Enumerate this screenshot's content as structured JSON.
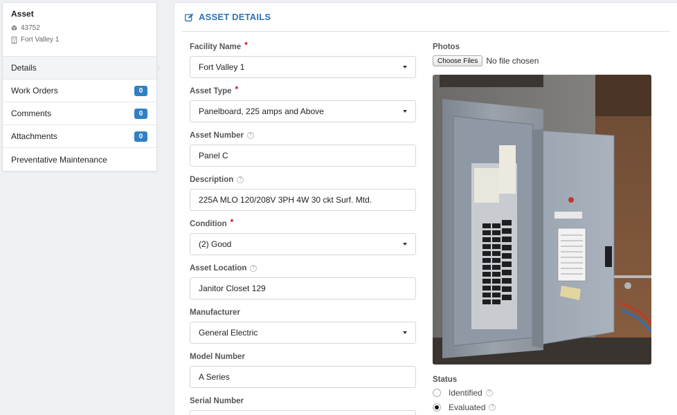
{
  "sidebar": {
    "asset_title": "Asset",
    "asset_id": "43752",
    "facility": "Fort Valley 1",
    "items": [
      {
        "label": "Details",
        "badge": null
      },
      {
        "label": "Work Orders",
        "badge": "0"
      },
      {
        "label": "Comments",
        "badge": "0"
      },
      {
        "label": "Attachments",
        "badge": "0"
      },
      {
        "label": "Preventative Maintenance",
        "badge": null
      }
    ]
  },
  "main": {
    "title": "ASSET DETAILS",
    "fields": {
      "facility_name": {
        "label": "Facility Name",
        "value": "Fort Valley 1"
      },
      "asset_type": {
        "label": "Asset Type",
        "value": "Panelboard, 225 amps and Above"
      },
      "asset_number": {
        "label": "Asset Number",
        "value": "Panel C"
      },
      "description": {
        "label": "Description",
        "value": "225A MLO 120/208V 3PH 4W 30 ckt Surf. Mtd."
      },
      "condition": {
        "label": "Condition",
        "value": "(2) Good"
      },
      "asset_location": {
        "label": "Asset Location",
        "value": "Janitor Closet 129"
      },
      "manufacturer": {
        "label": "Manufacturer",
        "value": "General Electric"
      },
      "model_number": {
        "label": "Model Number",
        "value": "A Series"
      },
      "serial_number": {
        "label": "Serial Number",
        "value": ""
      }
    },
    "photos": {
      "label": "Photos",
      "choose_label": "Choose Files",
      "no_file_text": "No file chosen"
    },
    "status": {
      "label": "Status",
      "options": [
        "Identified",
        "Evaluated"
      ],
      "selected": "Evaluated"
    }
  },
  "colors": {
    "accent": "#2a74b8",
    "badge": "#2f80c5",
    "required": "#d0021b"
  }
}
